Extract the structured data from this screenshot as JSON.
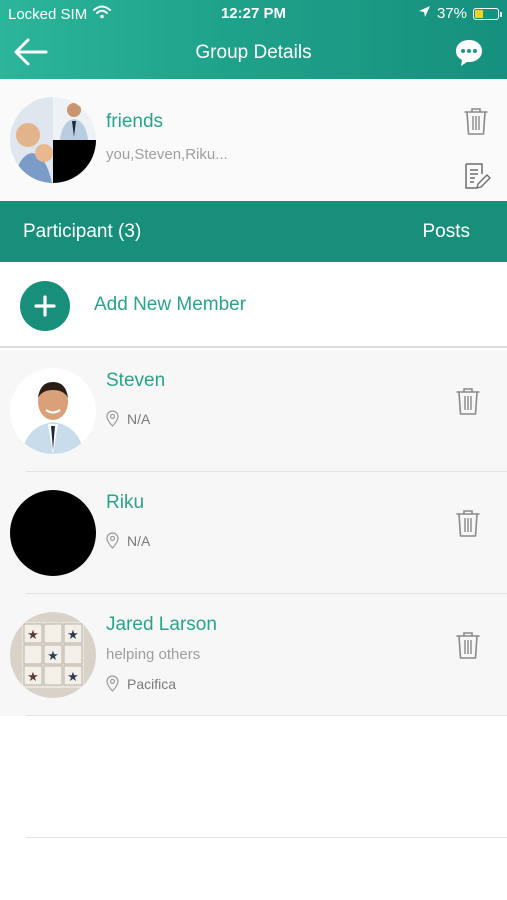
{
  "status_bar": {
    "carrier": "Locked SIM",
    "time": "12:27 PM",
    "battery_percent": "37%",
    "battery_level": 0.37
  },
  "nav": {
    "title": "Group Details",
    "back_icon": "back-arrow-icon",
    "chat_icon": "chat-bubble-icon"
  },
  "group": {
    "name": "friends",
    "members_preview": "you,Steven,Riku...",
    "delete_icon": "trash-icon",
    "edit_icon": "edit-note-icon"
  },
  "tabs": {
    "participants_label": "Participant (3)",
    "posts_label": "Posts"
  },
  "add_member": {
    "label": "Add New Member",
    "icon": "plus-icon"
  },
  "members": [
    {
      "name": "Steven",
      "location": "N/A",
      "status": ""
    },
    {
      "name": "Riku",
      "location": "N/A",
      "status": ""
    },
    {
      "name": "Jared Larson",
      "status": "helping others",
      "location": "Pacifica"
    }
  ],
  "colors": {
    "header_start": "#2bb59a",
    "header_end": "#16907e",
    "accent_teal": "#178f7a",
    "text_teal": "#2ba28a",
    "battery_yellow": "#ffd21f"
  }
}
